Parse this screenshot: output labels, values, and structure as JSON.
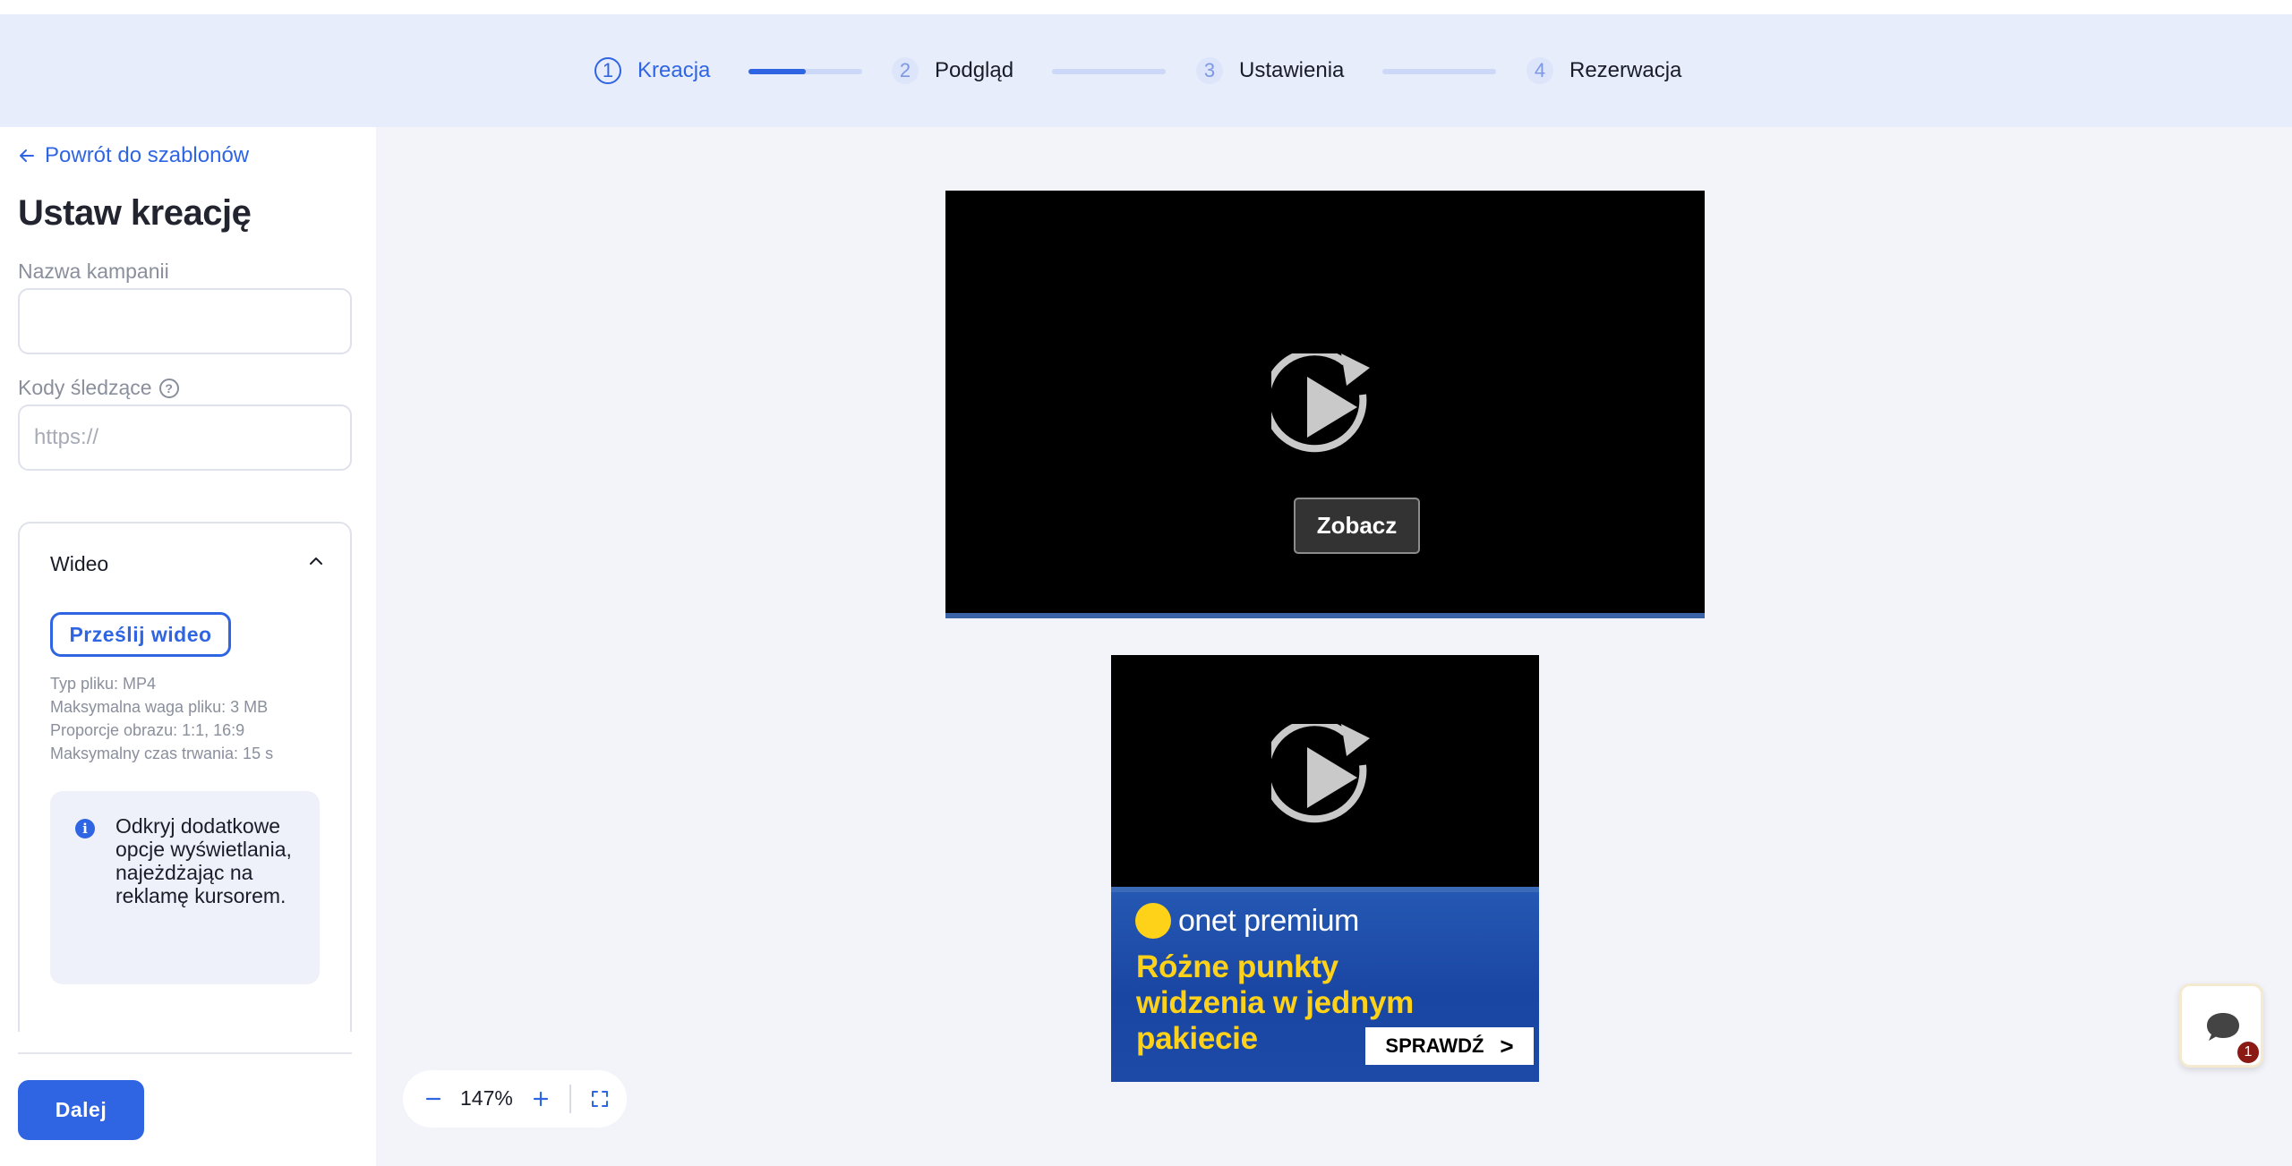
{
  "colors": {
    "accent": "#2f65e3",
    "stepper_bg": "#e8edfb",
    "canvas_bg": "#f3f4fa",
    "brand_yellow": "#ffd21a",
    "banner_blue": "#1c4aa6",
    "badge_red": "#8b1a15"
  },
  "stepper": {
    "steps": [
      {
        "number": "1",
        "label": "Kreacja",
        "active": true
      },
      {
        "number": "2",
        "label": "Podgląd",
        "active": false
      },
      {
        "number": "3",
        "label": "Ustawienia",
        "active": false
      },
      {
        "number": "4",
        "label": "Rezerwacja",
        "active": false
      }
    ],
    "current_progress": 0.5
  },
  "sidebar": {
    "back_link": "Powrót do szablonów",
    "title": "Ustaw kreację",
    "campaign_name": {
      "label": "Nazwa kampanii",
      "value": "",
      "placeholder": ""
    },
    "tracking_codes": {
      "label": "Kody śledzące",
      "value": "",
      "placeholder": "https://",
      "help_icon": "question-circle-icon"
    },
    "video_panel": {
      "title": "Wideo",
      "expanded": true,
      "upload_button": "Prześlij wideo",
      "specs": [
        "Typ pliku: MP4",
        "Maksymalna waga pliku: 3 MB",
        "Proporcje obrazu: 1:1, 16:9",
        "Maksymalny czas trwania: 15 s"
      ],
      "info": "Odkryj dodatkowe opcje wyświetlania, najeżdżając na reklamę kursorem."
    },
    "next_button": "Dalej"
  },
  "preview": {
    "ad_16x9": {
      "cta": "Zobacz",
      "icon": "replay-icon"
    },
    "ad_1x1": {
      "icon": "replay-icon",
      "brand": "onet premium",
      "headline": "Różne punkty widzenia w jednym pakiecie",
      "cta": "SPRAWDŹ"
    }
  },
  "zoom": {
    "value": "147%",
    "minus_icon": "minus-icon",
    "plus_icon": "plus-icon",
    "fit_icon": "fullscreen-icon"
  },
  "chat": {
    "icon": "chat-bubble-icon",
    "badge": "1"
  }
}
